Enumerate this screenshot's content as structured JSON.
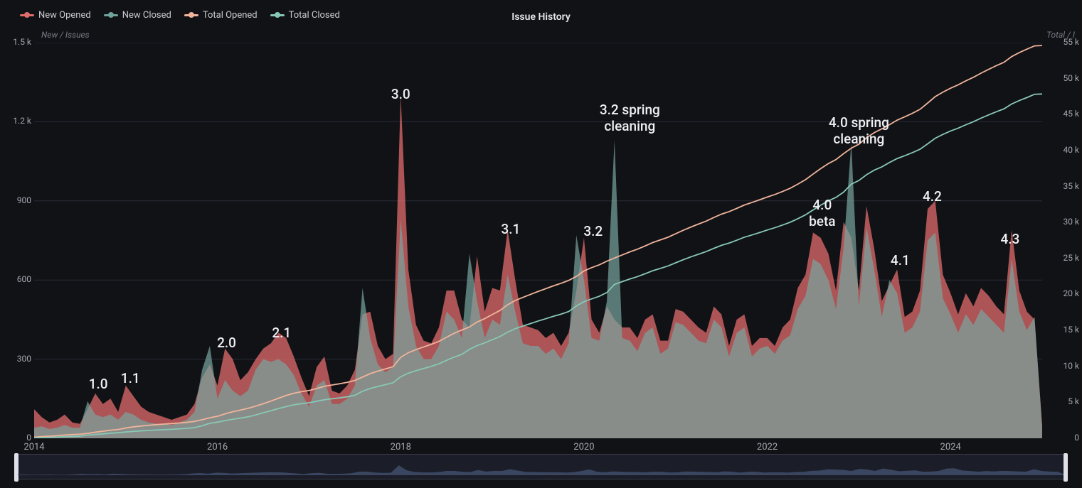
{
  "title": "Issue History",
  "axis_left_title": "New / Issues",
  "axis_right_title": "Total / I",
  "legend": [
    {
      "label": "New Opened",
      "color": "#e26c6c"
    },
    {
      "label": "New Closed",
      "color": "#6fa39c"
    },
    {
      "label": "Total Opened",
      "color": "#f0b49b"
    },
    {
      "label": "Total Closed",
      "color": "#88c7b6"
    }
  ],
  "y_left_ticks": [
    "0",
    "300",
    "600",
    "900",
    "1.2 k",
    "1.5 k"
  ],
  "y_right_ticks": [
    "0",
    "5 k",
    "10 k",
    "15 k",
    "20 k",
    "25 k",
    "30 k",
    "35 k",
    "40 k",
    "45 k",
    "50 k",
    "55 k"
  ],
  "x_ticks": [
    "2014",
    "2016",
    "2018",
    "2020",
    "2022",
    "2024"
  ],
  "annotations": [
    {
      "text": "1.0",
      "x": 2014.7,
      "y_offset": 470
    },
    {
      "text": "1.1",
      "x": 2015.05,
      "y_offset": 462
    },
    {
      "text": "2.0",
      "x": 2016.1,
      "y_offset": 412
    },
    {
      "text": "2.1",
      "x": 2016.7,
      "y_offset": 398
    },
    {
      "text": "3.0",
      "x": 2018.0,
      "y_offset": 62
    },
    {
      "text": "3.1",
      "x": 2019.2,
      "y_offset": 252
    },
    {
      "text": "3.2",
      "x": 2020.1,
      "y_offset": 255
    },
    {
      "text": "3.2 spring\ncleaning",
      "x": 2020.5,
      "y_offset": 84
    },
    {
      "text": "4.0\nbeta",
      "x": 2022.6,
      "y_offset": 218
    },
    {
      "text": "4.0 spring\ncleaning",
      "x": 2023.0,
      "y_offset": 102
    },
    {
      "text": "4.1",
      "x": 2023.45,
      "y_offset": 296
    },
    {
      "text": "4.2",
      "x": 2023.8,
      "y_offset": 206
    },
    {
      "text": "4.3",
      "x": 2024.65,
      "y_offset": 266
    }
  ],
  "chart_data": {
    "type": "area",
    "title": "Issue History",
    "xlabel": "",
    "ylabel_left": "New / Issues",
    "ylabel_right": "Total / Issues",
    "x_range": [
      2014.0,
      2025.0
    ],
    "y_left_range": [
      0,
      1500
    ],
    "y_right_range": [
      0,
      55000
    ],
    "x": [
      2014.0,
      2014.083,
      2014.167,
      2014.25,
      2014.333,
      2014.417,
      2014.5,
      2014.583,
      2014.667,
      2014.75,
      2014.833,
      2014.917,
      2015.0,
      2015.083,
      2015.167,
      2015.25,
      2015.333,
      2015.417,
      2015.5,
      2015.583,
      2015.667,
      2015.75,
      2015.833,
      2015.917,
      2016.0,
      2016.083,
      2016.167,
      2016.25,
      2016.333,
      2016.417,
      2016.5,
      2016.583,
      2016.667,
      2016.75,
      2016.833,
      2016.917,
      2017.0,
      2017.083,
      2017.167,
      2017.25,
      2017.333,
      2017.417,
      2017.5,
      2017.583,
      2017.667,
      2017.75,
      2017.833,
      2017.917,
      2018.0,
      2018.083,
      2018.167,
      2018.25,
      2018.333,
      2018.417,
      2018.5,
      2018.583,
      2018.667,
      2018.75,
      2018.833,
      2018.917,
      2019.0,
      2019.083,
      2019.167,
      2019.25,
      2019.333,
      2019.417,
      2019.5,
      2019.583,
      2019.667,
      2019.75,
      2019.833,
      2019.917,
      2020.0,
      2020.083,
      2020.167,
      2020.25,
      2020.333,
      2020.417,
      2020.5,
      2020.583,
      2020.667,
      2020.75,
      2020.833,
      2020.917,
      2021.0,
      2021.083,
      2021.167,
      2021.25,
      2021.333,
      2021.417,
      2021.5,
      2021.583,
      2021.667,
      2021.75,
      2021.833,
      2021.917,
      2022.0,
      2022.083,
      2022.167,
      2022.25,
      2022.333,
      2022.417,
      2022.5,
      2022.583,
      2022.667,
      2022.75,
      2022.833,
      2022.917,
      2023.0,
      2023.083,
      2023.167,
      2023.25,
      2023.333,
      2023.417,
      2023.5,
      2023.583,
      2023.667,
      2023.75,
      2023.833,
      2023.917,
      2024.0,
      2024.083,
      2024.167,
      2024.25,
      2024.333,
      2024.417,
      2024.5,
      2024.583,
      2024.667,
      2024.75,
      2024.833,
      2024.917,
      2025.0
    ],
    "series": [
      {
        "name": "New Opened",
        "axis": "left",
        "style": "area",
        "color": "#e26c6c",
        "values": [
          110,
          80,
          60,
          70,
          90,
          60,
          55,
          110,
          170,
          130,
          150,
          100,
          200,
          160,
          120,
          100,
          90,
          80,
          70,
          80,
          90,
          130,
          230,
          280,
          200,
          340,
          300,
          220,
          250,
          300,
          340,
          360,
          400,
          380,
          310,
          230,
          160,
          270,
          310,
          180,
          170,
          200,
          260,
          470,
          480,
          350,
          300,
          320,
          1300,
          640,
          430,
          370,
          360,
          420,
          560,
          560,
          450,
          420,
          690,
          480,
          570,
          560,
          790,
          600,
          430,
          420,
          410,
          380,
          400,
          350,
          400,
          560,
          760,
          450,
          400,
          500,
          450,
          420,
          420,
          380,
          450,
          470,
          370,
          370,
          490,
          480,
          450,
          420,
          400,
          500,
          470,
          350,
          450,
          470,
          350,
          380,
          380,
          350,
          420,
          450,
          570,
          620,
          780,
          760,
          700,
          560,
          820,
          760,
          560,
          880,
          720,
          520,
          580,
          640,
          460,
          480,
          560,
          870,
          900,
          620,
          550,
          470,
          550,
          500,
          570,
          540,
          500,
          470,
          790,
          560,
          480,
          450,
          50
        ]
      },
      {
        "name": "New Closed",
        "axis": "left",
        "style": "area",
        "color": "#6fa39c",
        "values": [
          40,
          45,
          35,
          40,
          50,
          40,
          40,
          140,
          90,
          80,
          90,
          70,
          100,
          90,
          70,
          60,
          55,
          55,
          50,
          60,
          70,
          100,
          260,
          350,
          150,
          220,
          180,
          160,
          180,
          260,
          300,
          290,
          300,
          280,
          240,
          170,
          120,
          200,
          220,
          130,
          130,
          150,
          200,
          570,
          380,
          280,
          250,
          270,
          830,
          500,
          350,
          300,
          300,
          350,
          480,
          450,
          380,
          700,
          520,
          380,
          450,
          430,
          620,
          480,
          360,
          350,
          350,
          320,
          340,
          300,
          360,
          770,
          600,
          380,
          370,
          520,
          1130,
          380,
          370,
          330,
          400,
          420,
          320,
          340,
          440,
          430,
          400,
          370,
          360,
          450,
          420,
          310,
          400,
          420,
          310,
          340,
          350,
          320,
          370,
          390,
          490,
          540,
          680,
          660,
          600,
          490,
          720,
          1120,
          500,
          800,
          640,
          460,
          600,
          550,
          400,
          420,
          480,
          750,
          780,
          530,
          470,
          400,
          470,
          430,
          490,
          460,
          430,
          400,
          680,
          480,
          410,
          460,
          40
        ]
      },
      {
        "name": "Total Opened",
        "axis": "right",
        "style": "line",
        "color": "#f0b49b",
        "values": [
          150,
          230,
          290,
          360,
          450,
          510,
          565,
          675,
          845,
          975,
          1125,
          1225,
          1425,
          1585,
          1705,
          1805,
          1895,
          1975,
          2045,
          2125,
          2215,
          2345,
          2575,
          2855,
          3055,
          3395,
          3695,
          3915,
          4165,
          4465,
          4805,
          5165,
          5565,
          5945,
          6255,
          6485,
          6645,
          6915,
          7225,
          7405,
          7575,
          7775,
          8035,
          8505,
          8985,
          9335,
          9635,
          9955,
          11255,
          11895,
          12325,
          12695,
          13055,
          13475,
          14035,
          14595,
          15045,
          15465,
          16155,
          16635,
          17205,
          17765,
          18555,
          19155,
          19585,
          20005,
          20415,
          20795,
          21195,
          21545,
          21945,
          22505,
          23265,
          23715,
          24115,
          24615,
          25065,
          25485,
          25905,
          26285,
          26735,
          27205,
          27575,
          27945,
          28435,
          28915,
          29365,
          29785,
          30185,
          30685,
          31155,
          31505,
          31955,
          32425,
          32775,
          33155,
          33535,
          33885,
          34305,
          34755,
          35325,
          35945,
          36725,
          37485,
          38185,
          38745,
          39565,
          40325,
          40885,
          41765,
          42485,
          43005,
          43585,
          44225,
          44685,
          45165,
          45725,
          46595,
          47495,
          48115,
          48665,
          49135,
          49685,
          50185,
          50755,
          51295,
          51795,
          52265,
          53055,
          53615,
          54095,
          54545,
          54595
        ]
      },
      {
        "name": "Total Closed",
        "axis": "right",
        "style": "line",
        "color": "#88c7b6",
        "values": [
          50,
          95,
          130,
          170,
          220,
          260,
          300,
          440,
          530,
          610,
          700,
          770,
          870,
          960,
          1030,
          1090,
          1145,
          1200,
          1250,
          1310,
          1380,
          1480,
          1740,
          2090,
          2240,
          2460,
          2640,
          2800,
          2980,
          3240,
          3540,
          3830,
          4130,
          4410,
          4650,
          4820,
          4940,
          5140,
          5360,
          5490,
          5620,
          5770,
          5970,
          6540,
          6920,
          7200,
          7450,
          7720,
          8550,
          9050,
          9400,
          9700,
          10000,
          10350,
          10830,
          11280,
          11660,
          12360,
          12880,
          13260,
          13710,
          14140,
          14760,
          15240,
          15600,
          15950,
          16300,
          16620,
          16960,
          17260,
          17620,
          18390,
          18990,
          19370,
          19740,
          20260,
          21390,
          21770,
          22140,
          22470,
          22870,
          23290,
          23610,
          23950,
          24390,
          24820,
          25220,
          25590,
          25950,
          26400,
          26820,
          27130,
          27530,
          27950,
          28260,
          28600,
          28950,
          29270,
          29640,
          30030,
          30520,
          31060,
          31740,
          32400,
          33000,
          33490,
          34210,
          35330,
          35830,
          36630,
          37270,
          37730,
          38330,
          38880,
          39280,
          39700,
          40180,
          40930,
          41710,
          42240,
          42710,
          43110,
          43580,
          44010,
          44500,
          44960,
          45390,
          45790,
          46470,
          46950,
          47360,
          47820,
          47860
        ]
      }
    ],
    "annotations": [
      {
        "label": "1.0",
        "x": 2014.7
      },
      {
        "label": "1.1",
        "x": 2015.05
      },
      {
        "label": "2.0",
        "x": 2016.1
      },
      {
        "label": "2.1",
        "x": 2016.7
      },
      {
        "label": "3.0",
        "x": 2018.0
      },
      {
        "label": "3.1",
        "x": 2019.2
      },
      {
        "label": "3.2",
        "x": 2020.1
      },
      {
        "label": "3.2 spring cleaning",
        "x": 2020.5
      },
      {
        "label": "4.0 beta",
        "x": 2022.6
      },
      {
        "label": "4.0 spring cleaning",
        "x": 2023.0
      },
      {
        "label": "4.1",
        "x": 2023.45
      },
      {
        "label": "4.2",
        "x": 2023.8
      },
      {
        "label": "4.3",
        "x": 2024.65
      }
    ]
  }
}
